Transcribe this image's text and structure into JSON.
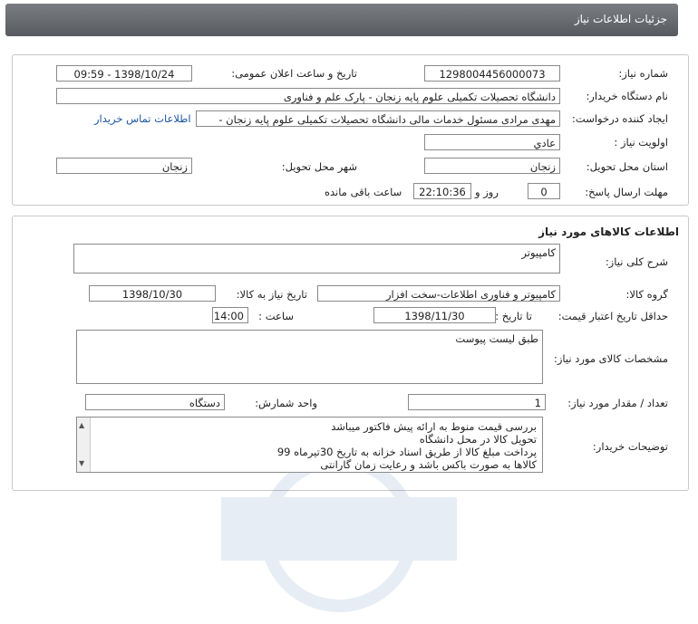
{
  "header": {
    "title": "جزئیات اطلاعات نیاز"
  },
  "info": {
    "need_number_label": "شماره نیاز:",
    "need_number": "1298004456000073",
    "announce_label": "تاریخ و ساعت اعلان عمومی:",
    "announce_value": "1398/10/24 - 09:59",
    "buyer_label": "نام دستگاه خریدار:",
    "buyer_value": "دانشگاه تحصیلات تکمیلی علوم پایه زنجان - پارک علم و فناوری",
    "creator_label": "ایجاد کننده درخواست:",
    "creator_value": "مهدی مرادی مسئول خدمات مالی دانشگاه تحصیلات تکمیلی علوم پایه زنجان -",
    "contact_link": "اطلاعات تماس خریدار",
    "priority_label": "اولویت نیاز :",
    "priority_value": "عادي",
    "province_label": "استان محل تحویل:",
    "province_value": "زنجان",
    "city_label": "شهر محل تحویل:",
    "city_value": "زنجان",
    "deadline_label": "مهلت ارسال پاسخ:",
    "days_value": "0",
    "days_text": "روز و",
    "time_value": "22:10:36",
    "remaining_text": "ساعت باقی مانده"
  },
  "goods": {
    "title": "اطلاعات کالاهای مورد نیاز",
    "summary_label": "شرح کلی نیاز:",
    "summary_value": "کامپیوتر",
    "group_label": "گروه کالا:",
    "group_value": "کامپیوتر و فناوری اطلاعات-سخت افزار",
    "need_date_label": "تاریخ نیاز به کالا:",
    "need_date_value": "1398/10/30",
    "validity_label": "حداقل تاریخ اعتبار قیمت:",
    "until_date_label": "تا تاریخ :",
    "until_date_value": "1398/11/30",
    "hour_label": "ساعت :",
    "hour_value": "14:00",
    "specs_label": "مشخصات کالای مورد نیاز:",
    "specs_value": "طبق لیست پیوست",
    "qty_label": "تعداد / مقدار مورد نیاز:",
    "qty_value": "1",
    "unit_label": "واحد شمارش:",
    "unit_value": "دستگاه",
    "notes_label": "توضیحات خریدار:",
    "notes_lines": [
      "بررسی قیمت منوط به ارائه پیش فاکتور میباشد",
      "تحویل کالا در محل دانشگاه",
      "پرداخت مبلغ کالا از طریق اسناد خزانه به تاریخ 30تیرماه 99",
      "کالاها به صورت باکس باشد و رعایت زمان گارانتی"
    ]
  }
}
